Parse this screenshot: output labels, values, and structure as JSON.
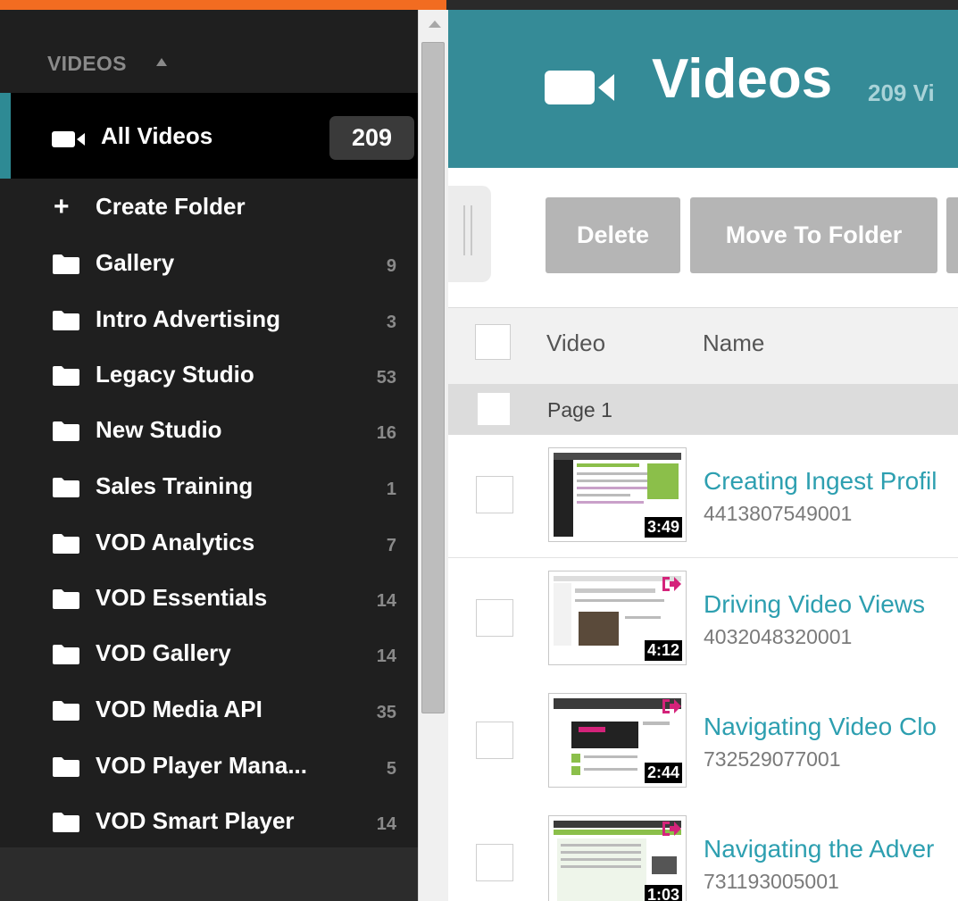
{
  "sidebar": {
    "section_header": "VIDEOS",
    "all_videos": {
      "label": "All Videos",
      "count": "209"
    },
    "create_folder_label": "Create Folder",
    "folders": [
      {
        "label": "Gallery",
        "count": "9"
      },
      {
        "label": "Intro Advertising",
        "count": "3"
      },
      {
        "label": "Legacy Studio",
        "count": "53"
      },
      {
        "label": "New Studio",
        "count": "16"
      },
      {
        "label": "Sales Training",
        "count": "1"
      },
      {
        "label": "VOD Analytics",
        "count": "7"
      },
      {
        "label": "VOD Essentials",
        "count": "14"
      },
      {
        "label": "VOD Gallery",
        "count": "14"
      },
      {
        "label": "VOD Media API",
        "count": "35"
      },
      {
        "label": "VOD Player Mana...",
        "count": "5"
      },
      {
        "label": "VOD Smart Player",
        "count": "14"
      }
    ]
  },
  "header": {
    "title": "Videos",
    "count_text": "209 Vi"
  },
  "toolbar": {
    "delete_label": "Delete",
    "move_label": "Move To Folder"
  },
  "table": {
    "columns": {
      "video": "Video",
      "name": "Name"
    },
    "page_label": "Page 1",
    "rows": [
      {
        "name": "Creating Ingest Profil",
        "id": "4413807549001",
        "duration": "3:49"
      },
      {
        "name": "Driving Video Views",
        "id": "4032048320001",
        "duration": "4:12"
      },
      {
        "name": "Navigating Video Clo",
        "id": "732529077001",
        "duration": "2:44"
      },
      {
        "name": "Navigating the Adver",
        "id": "731193005001",
        "duration": "1:03"
      }
    ]
  },
  "colors": {
    "brand_orange": "#f26c21",
    "header_teal": "#358b97",
    "link_teal": "#2d9fb0",
    "share_magenta": "#d4237a"
  }
}
